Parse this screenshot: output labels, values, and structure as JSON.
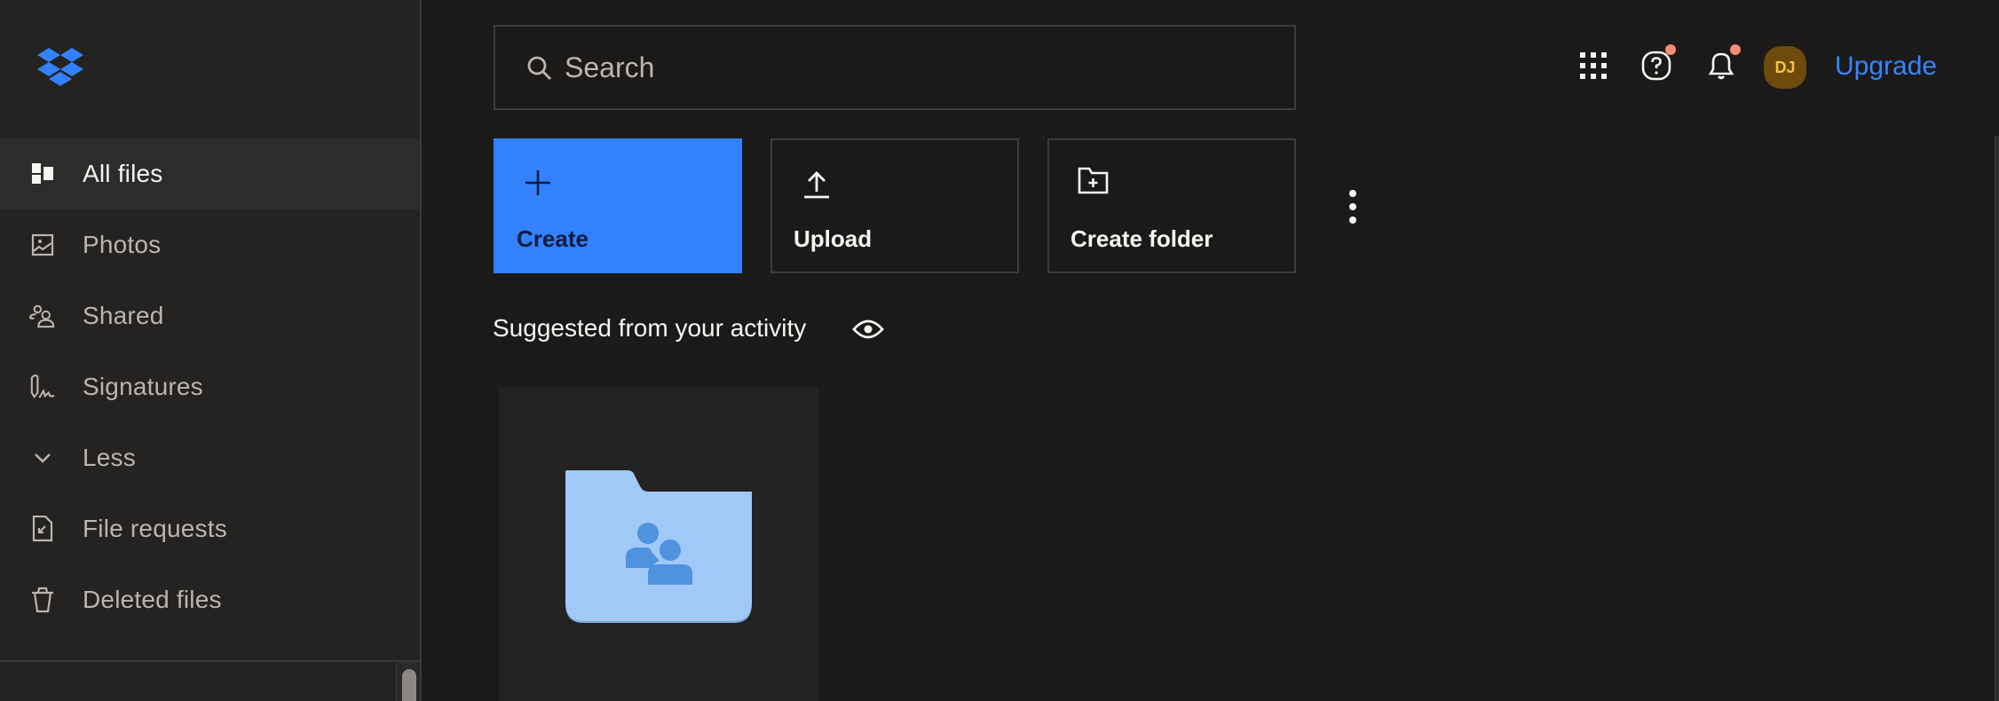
{
  "sidebar": {
    "logo": "dropbox-logo",
    "items": [
      {
        "label": "All files",
        "icon": "all-files-icon",
        "active": true
      },
      {
        "label": "Photos",
        "icon": "photo-icon",
        "active": false
      },
      {
        "label": "Shared",
        "icon": "shared-users-icon",
        "active": false
      },
      {
        "label": "Signatures",
        "icon": "signature-icon",
        "active": false
      },
      {
        "label": "Less",
        "icon": "chevron-down-icon",
        "active": false
      },
      {
        "label": "File requests",
        "icon": "file-request-icon",
        "active": false
      },
      {
        "label": "Deleted files",
        "icon": "trash-icon",
        "active": false
      }
    ]
  },
  "search": {
    "placeholder": "Search",
    "value": ""
  },
  "topbar": {
    "apps_icon": "app-grid-icon",
    "help_icon": "help-icon",
    "notifications_icon": "bell-icon",
    "avatar_initials": "DJ",
    "upgrade_label": "Upgrade"
  },
  "actions": [
    {
      "label": "Create",
      "icon": "plus-icon"
    },
    {
      "label": "Upload",
      "icon": "upload-icon"
    },
    {
      "label": "Create folder",
      "icon": "folder-plus-icon"
    }
  ],
  "suggested": {
    "title": "Suggested from your activity",
    "items": [
      {
        "type": "shared-folder",
        "icon": "shared-folder-icon"
      }
    ]
  },
  "colors": {
    "accent": "#3381ff",
    "link": "#3984ff",
    "notification_dot": "#f48d73",
    "avatar_bg": "#6e4a0d",
    "avatar_text": "#f7c242",
    "folder": "#a1c9f7",
    "folder_glyph": "#4e92e0"
  }
}
